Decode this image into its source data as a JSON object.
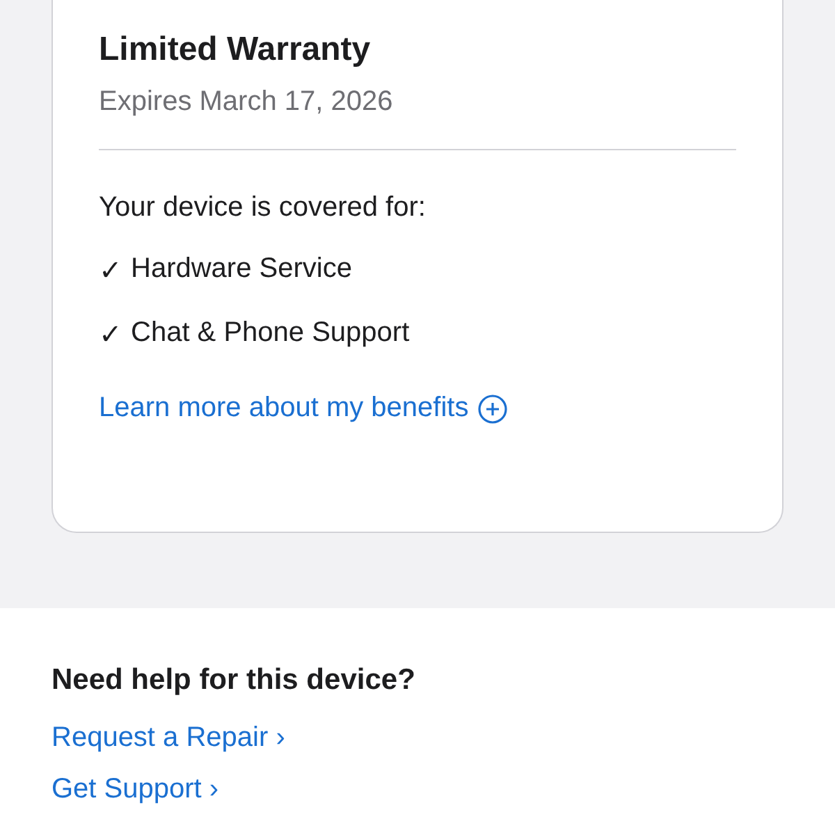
{
  "warranty_card": {
    "title": "Limited Warranty",
    "expiry": "Expires March 17, 2026",
    "coverage_heading": "Your device is covered for:",
    "coverage_items": [
      {
        "check": "✓",
        "label": "Hardware Service"
      },
      {
        "check": "✓",
        "label": "Chat & Phone Support"
      }
    ],
    "benefits_link": "Learn more about my benefits"
  },
  "help_section": {
    "heading": "Need help for this device?",
    "links": [
      {
        "label": "Request a Repair",
        "chevron": "›"
      },
      {
        "label": "Get Support",
        "chevron": "›"
      }
    ]
  }
}
